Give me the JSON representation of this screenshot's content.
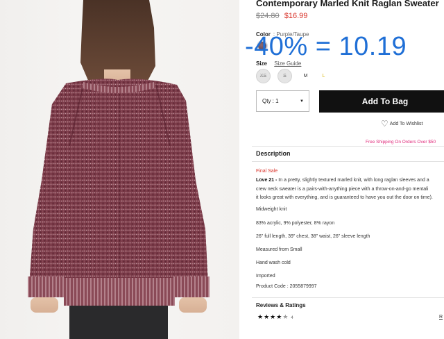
{
  "product": {
    "title": "Contemporary Marled Knit Raglan Sweater",
    "original_price": "$24.80",
    "sale_price": "$16.99"
  },
  "color": {
    "label": "Color",
    "value": ": Purple/Taupe"
  },
  "overlay_text": "-40% = 10.19",
  "size": {
    "label": "Size",
    "guide_link": "Size Guide",
    "options": [
      "XS",
      "S",
      "M",
      "L"
    ]
  },
  "quantity": {
    "label": "Qty : 1"
  },
  "add_to_bag": "Add To Bag",
  "wishlist": "Add To Wishlist",
  "free_shipping": "Free Shipping On Orders Over $50",
  "description": {
    "heading": "Description",
    "final_sale": "Final Sale",
    "brand": "Love 21 -",
    "line1": " In a pretty, slightly textured marled knit, with long raglan sleeves and a",
    "line2": "crew neck sweater is a pairs-with-anything piece with a throw-on-and-go mentali",
    "line3": "it looks great with everything, and is guaranteed to have you out the door on time).",
    "details": [
      "Midweight knit",
      "83% acrylic, 9% polyester, 8% rayon",
      "26\" full length, 39\" chest, 38\" waist, 26\" sleeve length",
      "Measured from Small",
      "Hand wash cold",
      "Imported",
      "Product Code : 2055879997"
    ]
  },
  "reviews": {
    "heading": "Reviews & Ratings",
    "rating": 4,
    "max_rating": 5,
    "count": "4",
    "write_link": "R"
  }
}
